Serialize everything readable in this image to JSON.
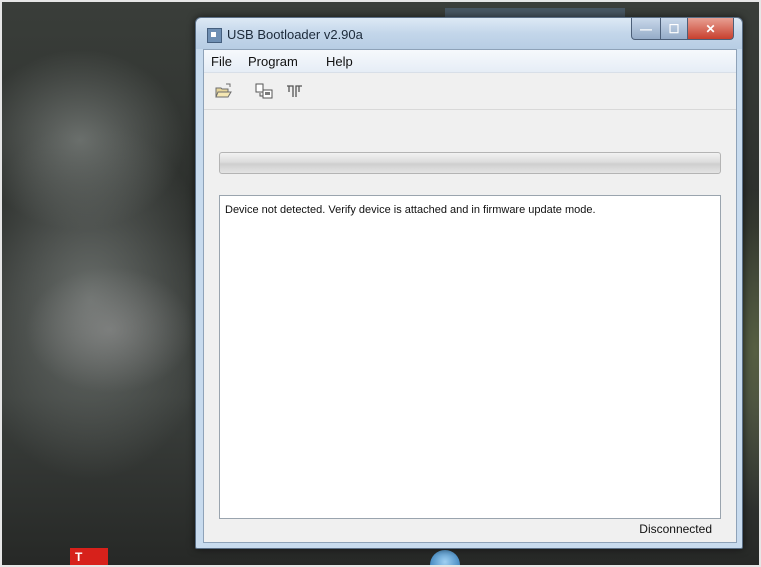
{
  "window": {
    "title": "USB Bootloader v2.90a",
    "buttons": {
      "minimize_glyph": "—",
      "maximize_glyph": "☐",
      "close_glyph": "✕"
    }
  },
  "menu": {
    "items": [
      {
        "label": "File"
      },
      {
        "label": "Program"
      },
      {
        "label": "Help"
      }
    ]
  },
  "toolbar": {
    "items": [
      {
        "icon": "open-file-icon"
      },
      {
        "icon": "program-device-icon"
      },
      {
        "icon": "reset-device-icon"
      }
    ]
  },
  "progress": {
    "value": 0
  },
  "log": {
    "message": "Device not detected.  Verify device is attached and in firmware update mode."
  },
  "status": {
    "text": "Disconnected"
  },
  "colors": {
    "close_button": "#c8402e",
    "title_bar": "#c8dbee",
    "progress_fill": "#35c72e"
  },
  "desktop": {
    "taskbar_icon_label": "T"
  }
}
